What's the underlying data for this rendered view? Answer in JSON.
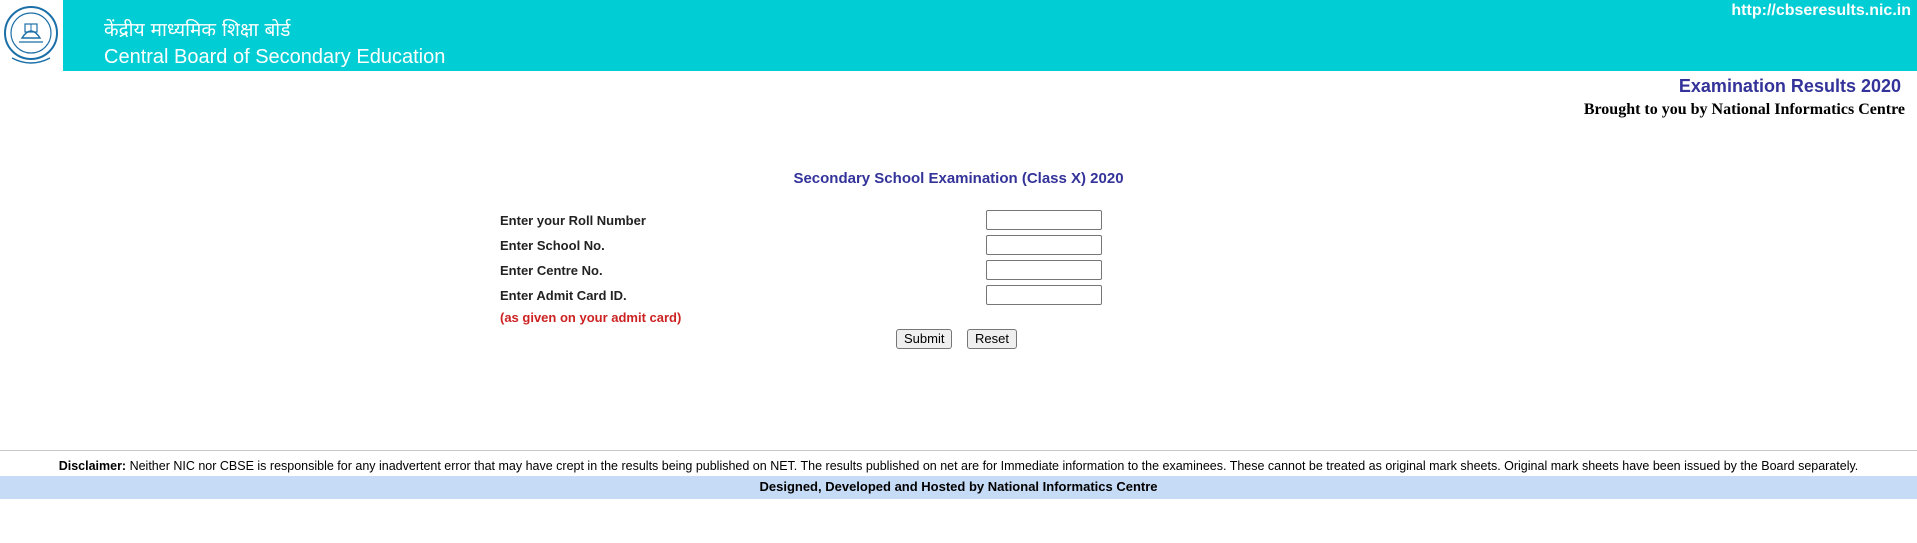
{
  "header": {
    "logo_icon": "cbse-emblem-icon",
    "hindi_title": "केंद्रीय माध्यमिक शिक्षा बोर्ड",
    "english_title": "Central Board of Secondary Education",
    "site_url": "http://cbseresults.nic.in",
    "bg_color": "#00cdd4"
  },
  "banner": {
    "heading": "Examination Results 2020",
    "brought_by": "Brought to you by National Informatics Centre",
    "heading_color": "#33339a"
  },
  "form": {
    "title": "Secondary School Examination (Class X) 2020",
    "fields": [
      {
        "label": "Enter your Roll Number",
        "value": ""
      },
      {
        "label": "Enter School No.",
        "value": ""
      },
      {
        "label": "Enter Centre No.",
        "value": ""
      },
      {
        "label": "Enter Admit Card ID.",
        "value": ""
      }
    ],
    "admit_note": "(as given on your admit card)",
    "note_color": "#cc2222",
    "submit_label": "Submit",
    "reset_label": "Reset"
  },
  "footer": {
    "disclaimer_label": "Disclaimer:",
    "disclaimer_text": " Neither NIC nor CBSE is responsible for any inadvertent error that may have crept in the results being published on NET. The results published on net are for Immediate information to the examinees. These cannot be treated as original mark sheets. Original mark sheets have been issued by the Board separately.",
    "credit": "Designed, Developed and Hosted by National Informatics Centre",
    "bar_color": "#c6dbf6"
  }
}
